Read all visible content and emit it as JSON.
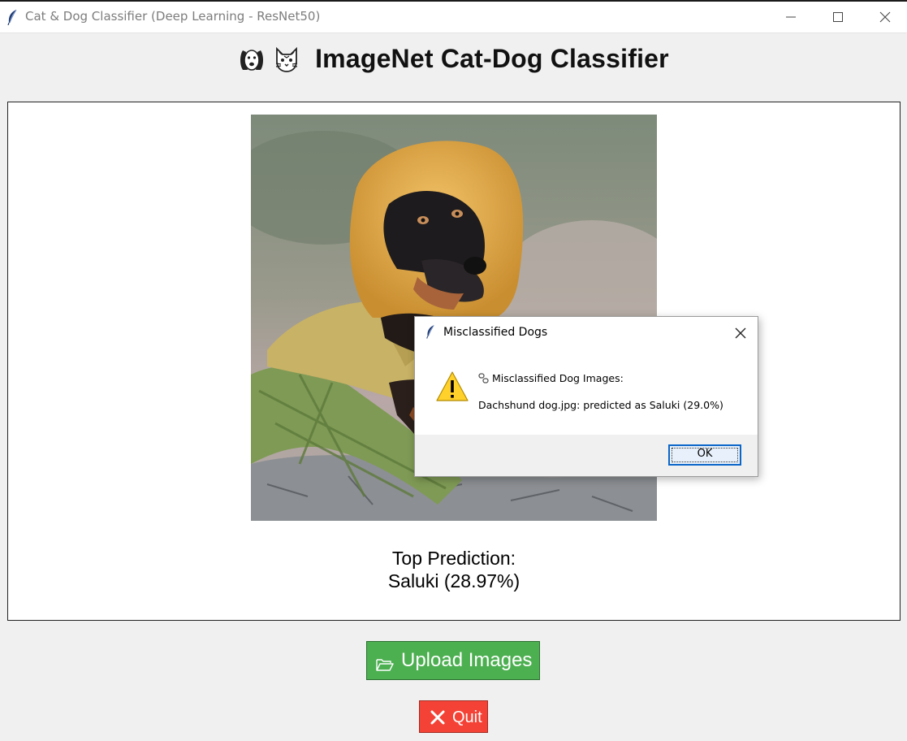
{
  "window": {
    "title": "Cat & Dog Classifier (Deep Learning - ResNet50)",
    "icon": "feather-icon"
  },
  "header": {
    "icons": [
      "dog-face-icon",
      "cat-face-icon"
    ],
    "title": "ImageNet Cat-Dog Classifier"
  },
  "main": {
    "image_alt": "dachshund-photo",
    "prediction_label": "Top Prediction:",
    "prediction_value": "Saluki (28.97%)"
  },
  "buttons": {
    "upload_icon": "folder-open-icon",
    "upload_label": "Upload Images",
    "quit_icon": "cross-icon",
    "quit_label": "Quit"
  },
  "dialog": {
    "title": "Misclassified Dogs",
    "heading_icon": "link-icon",
    "heading": "Misclassified Dog Images:",
    "message": "Dachshund dog.jpg: predicted as Saluki (29.0%)",
    "ok_label": "OK"
  },
  "colors": {
    "upload_button": "#4caf50",
    "quit_button": "#f44336",
    "ok_focus": "#0b66c9"
  }
}
